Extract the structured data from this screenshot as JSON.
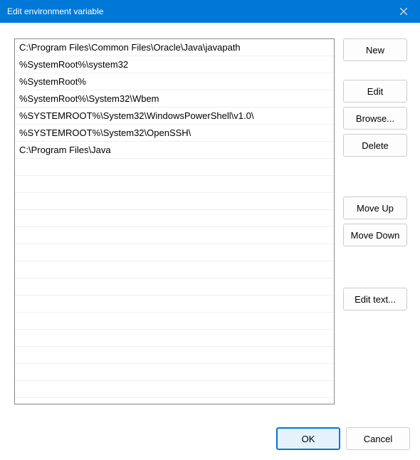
{
  "titlebar": {
    "title": "Edit environment variable"
  },
  "list": {
    "items": [
      "C:\\Program Files\\Common Files\\Oracle\\Java\\javapath",
      "%SystemRoot%\\system32",
      "%SystemRoot%",
      "%SystemRoot%\\System32\\Wbem",
      "%SYSTEMROOT%\\System32\\WindowsPowerShell\\v1.0\\",
      "%SYSTEMROOT%\\System32\\OpenSSH\\",
      "C:\\Program Files\\Java"
    ]
  },
  "buttons": {
    "new": "New",
    "edit": "Edit",
    "browse": "Browse...",
    "delete": "Delete",
    "moveUp": "Move Up",
    "moveDown": "Move Down",
    "editText": "Edit text...",
    "ok": "OK",
    "cancel": "Cancel"
  }
}
